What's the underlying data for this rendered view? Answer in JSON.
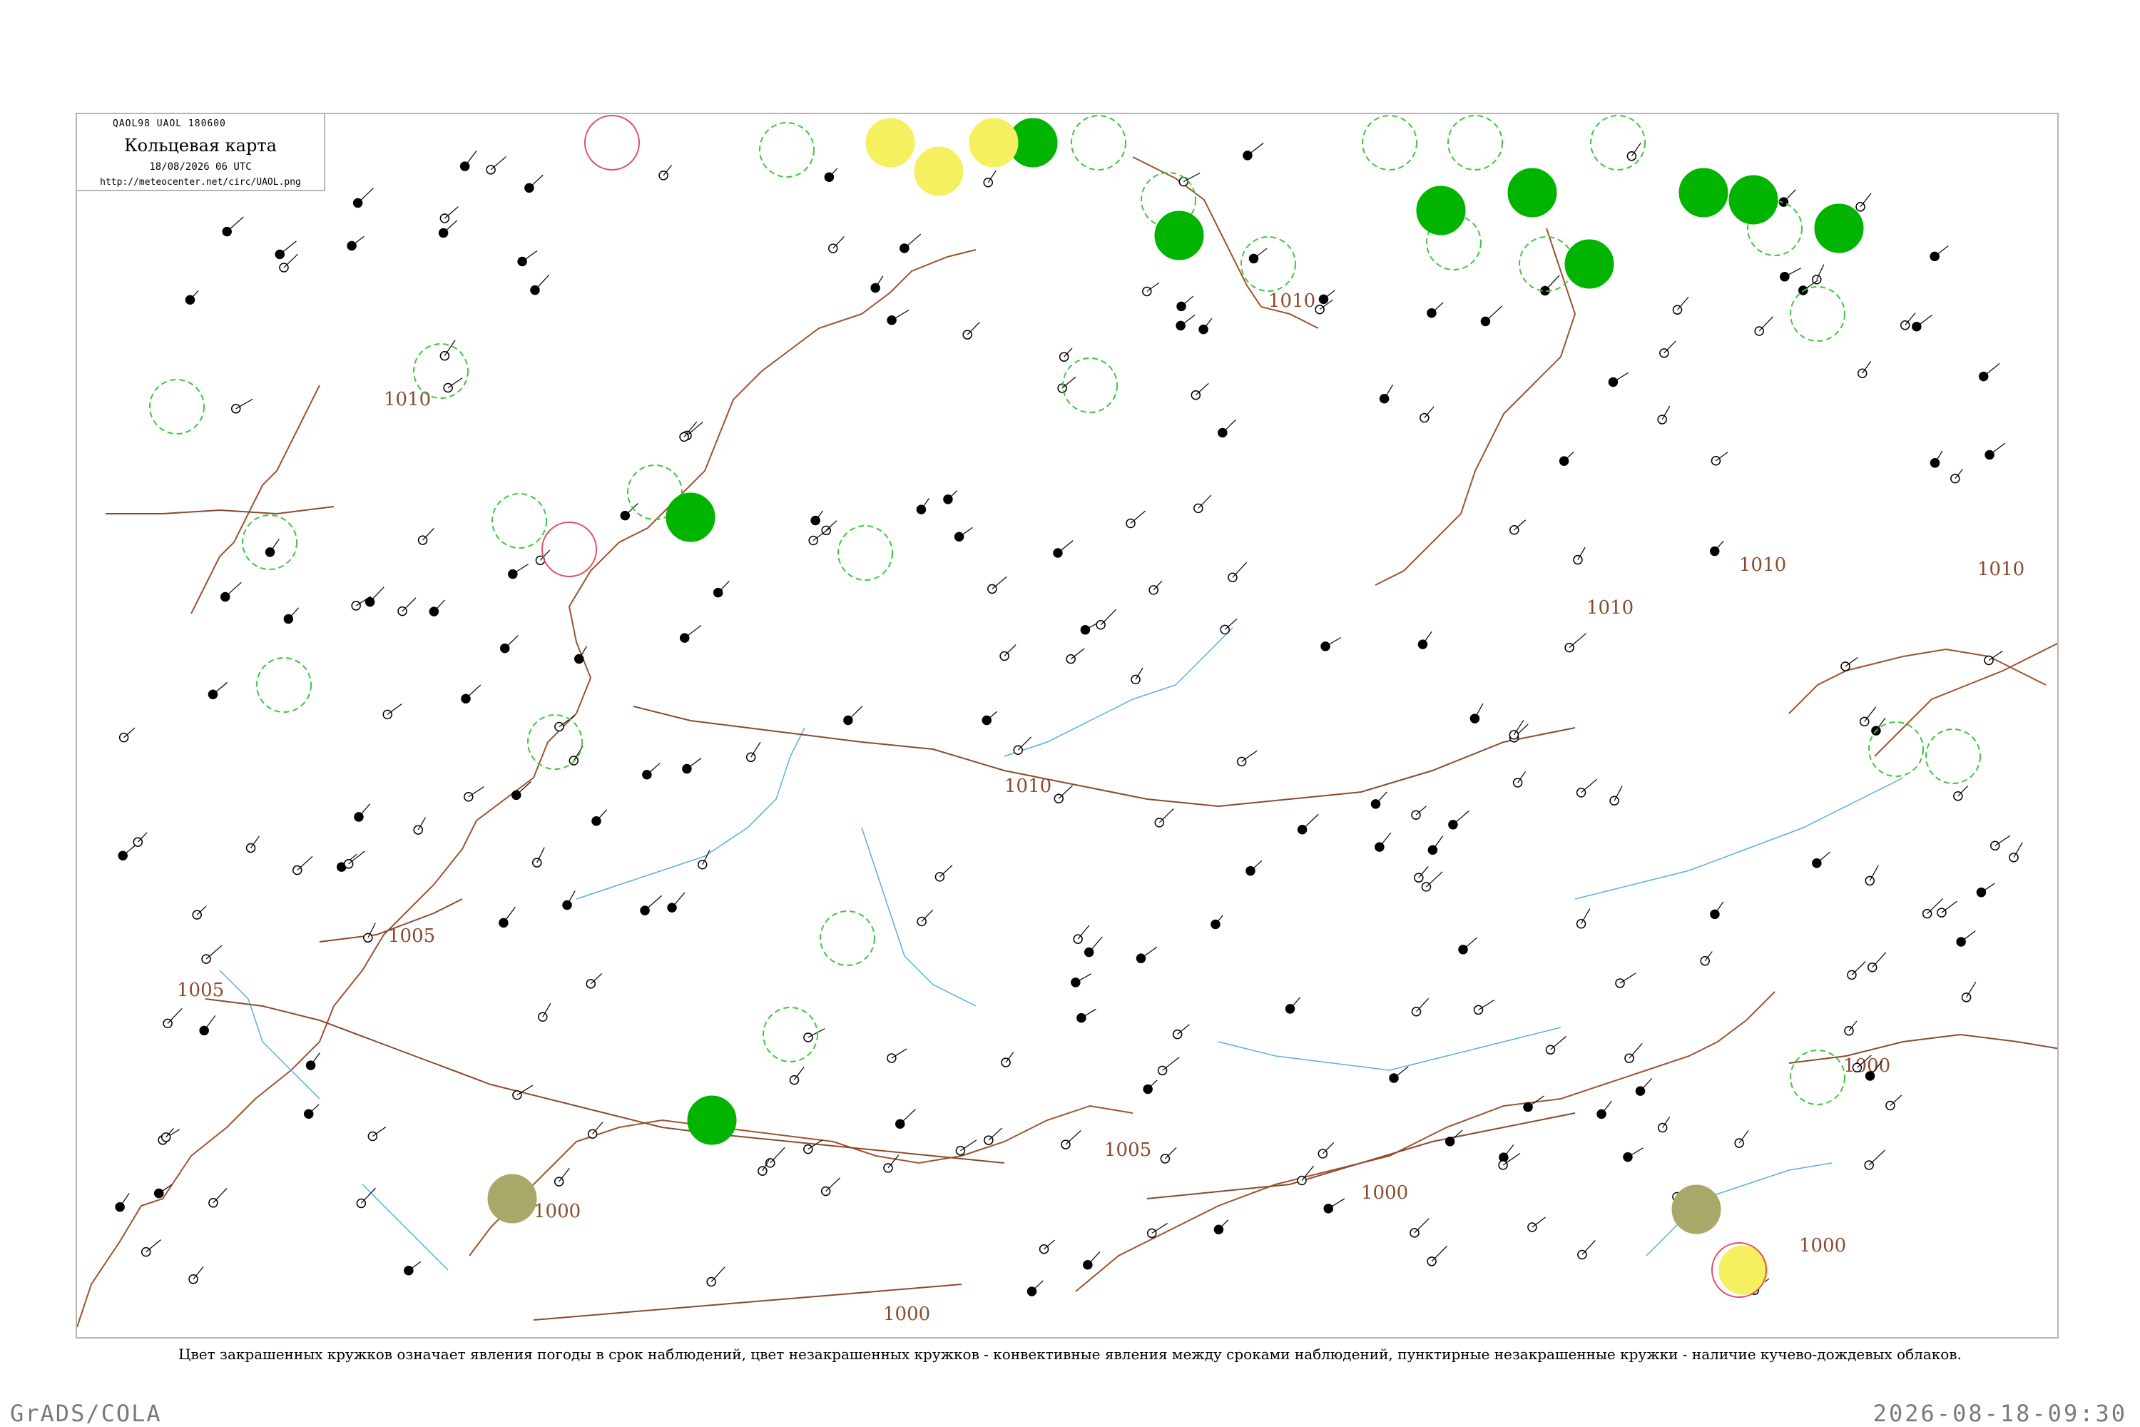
{
  "map": {
    "code_line": "QAOL98  UAOL  180600",
    "title": "Кольцевая карта",
    "date": "18/08/2026 06 UTC",
    "url": "http://meteocenter.net/circ/UAOL.png",
    "isobars": [
      "1010",
      "1010",
      "1010",
      "1010",
      "1010",
      "1010",
      "1005",
      "1005",
      "1005",
      "1000",
      "1000",
      "1000",
      "1000",
      "1000"
    ],
    "colors": {
      "land_border": "#a0522d",
      "rivers": "#5aaee6",
      "isobar_line": "#8a4a2f",
      "precip_green": "#00b400",
      "dashed_green": "#3cc83c",
      "fog_yellow": "#f5f060",
      "haze_olive": "#a8a868",
      "thunder_red": "#e0506a"
    }
  },
  "legend": {
    "caption": "Цвет закрашенных кружков означает явления погоды в срок наблюдений, цвет незакрашенных кружков - конвективные явления между сроками наблюдений, пунктирные незакрашенные кружки - наличие кучево-дождевых облаков."
  },
  "footer": {
    "left": "GrADS/COLA",
    "right": "2026-08-18-09:30"
  }
}
